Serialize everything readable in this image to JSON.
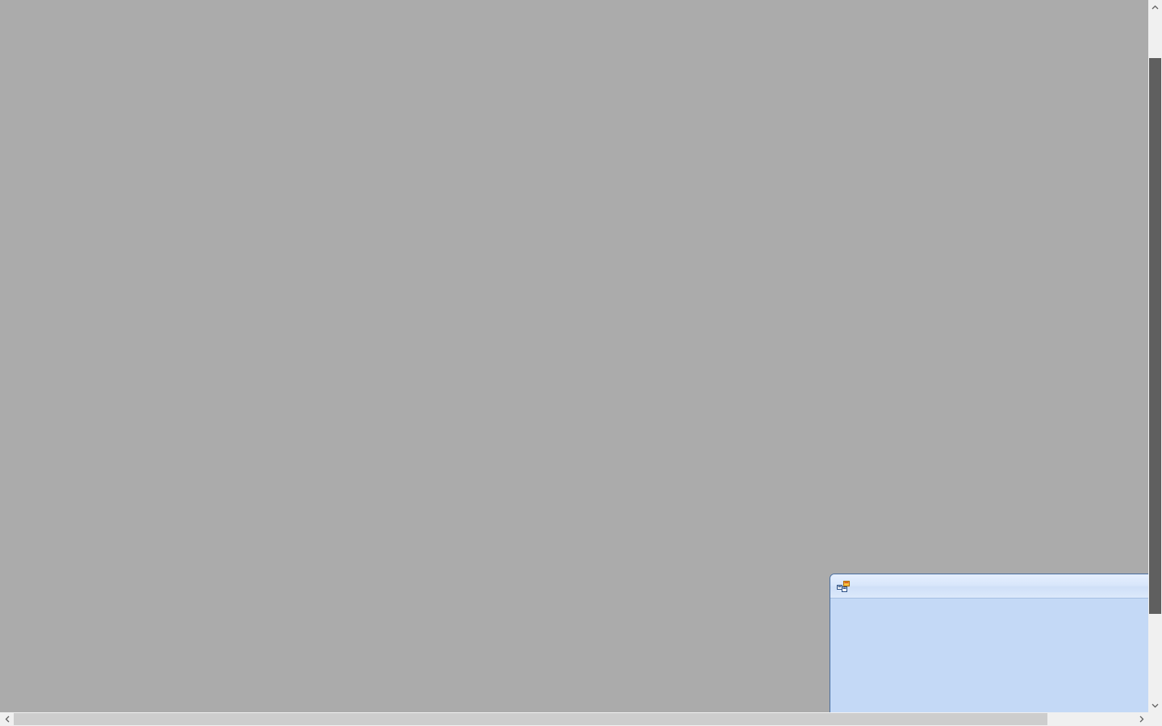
{
  "workspace": {
    "background": "#ababab"
  },
  "child_window": {
    "title": "",
    "icon": "form-window-icon",
    "body_color": "#c4d9f6"
  },
  "scrollbars": {
    "vertical": {
      "up_icon": "chevron-up-icon",
      "down_icon": "chevron-down-icon"
    },
    "horizontal": {
      "left_icon": "chevron-left-icon",
      "right_icon": "chevron-right-icon"
    }
  }
}
